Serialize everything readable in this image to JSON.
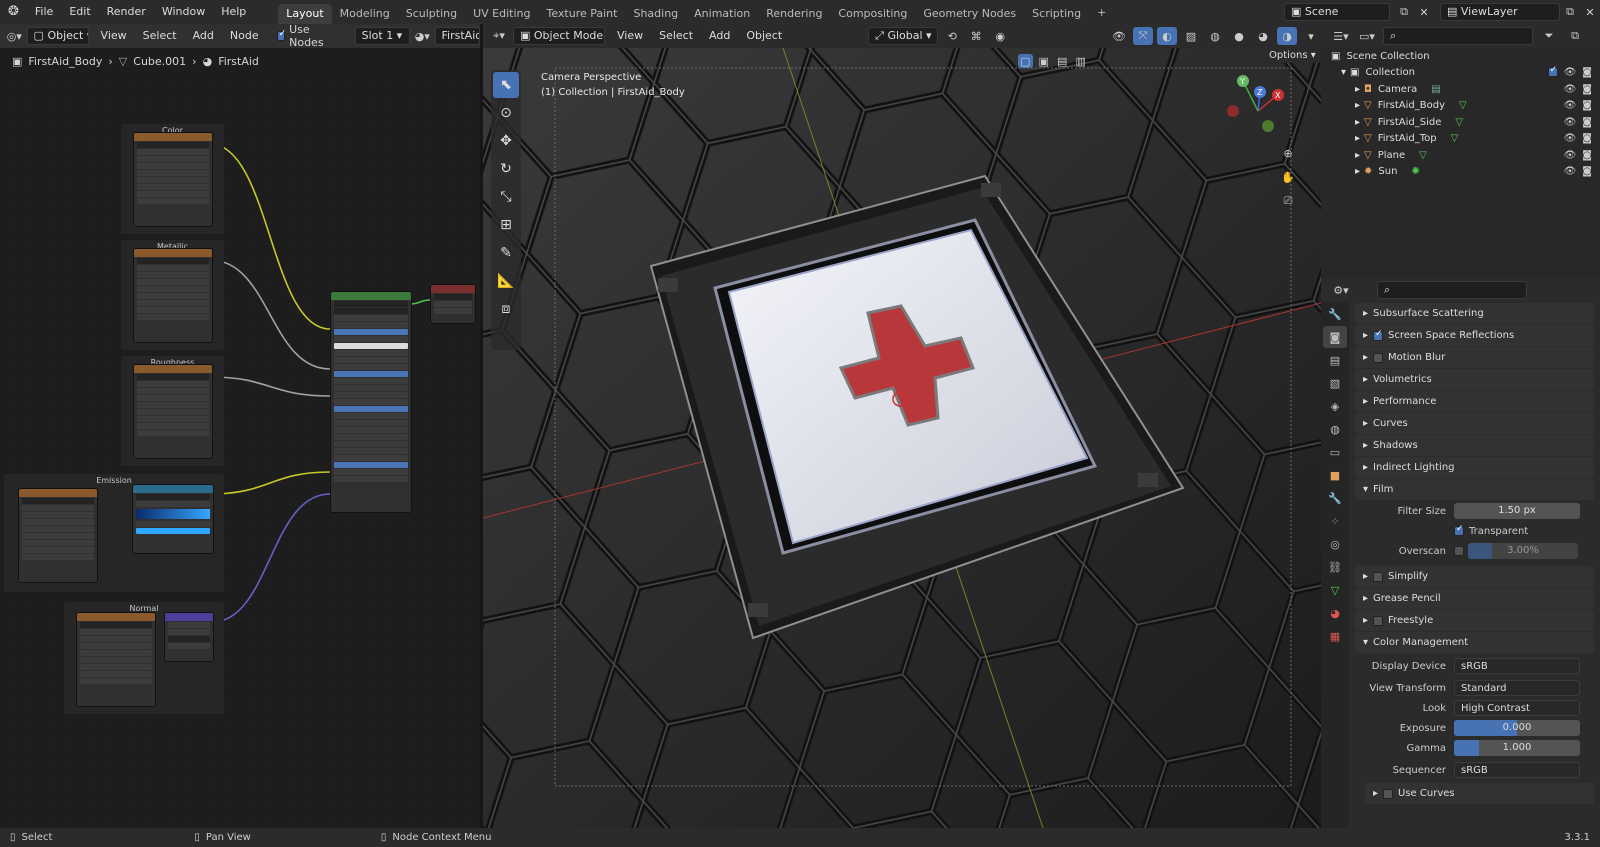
{
  "topbar": {
    "menus": [
      "File",
      "Edit",
      "Render",
      "Window",
      "Help"
    ],
    "workspaces": [
      "Layout",
      "Modeling",
      "Sculpting",
      "UV Editing",
      "Texture Paint",
      "Shading",
      "Animation",
      "Rendering",
      "Compositing",
      "Geometry Nodes",
      "Scripting"
    ],
    "active_workspace": "Layout",
    "add_tab": "+",
    "scene_name": "Scene",
    "view_layer": "ViewLayer"
  },
  "node_editor": {
    "type_label": "Object",
    "menus": [
      "View",
      "Select",
      "Add",
      "Node"
    ],
    "use_nodes_label": "Use Nodes",
    "slot": "Slot 1",
    "material": "FirstAid",
    "breadcrumb": [
      "FirstAid_Body",
      "Cube.001",
      "FirstAid"
    ],
    "frames": {
      "color": "Color",
      "metallic": "Metallic",
      "roughness": "Roughness",
      "emission": "Emission",
      "normal": "Normal"
    }
  },
  "viewport": {
    "mode": "Object Mode",
    "menus": [
      "View",
      "Select",
      "Add",
      "Object"
    ],
    "transform_orientation": "Global",
    "options_label": "Options",
    "overlay_title": "Camera Perspective",
    "overlay_sub": "(1) Collection | FirstAid_Body",
    "gizmo": {
      "x": "X",
      "y": "Y",
      "z": "Z"
    }
  },
  "outliner": {
    "root": "Scene Collection",
    "collection": "Collection",
    "items": [
      "Camera",
      "FirstAid_Body",
      "FirstAid_Side",
      "FirstAid_Top",
      "Plane",
      "Sun"
    ]
  },
  "properties": {
    "sections_top": [
      {
        "label": "Subsurface Scattering",
        "checkbox": null
      },
      {
        "label": "Screen Space Reflections",
        "checkbox": true
      },
      {
        "label": "Motion Blur",
        "checkbox": false
      },
      {
        "label": "Volumetrics",
        "checkbox": null
      },
      {
        "label": "Performance",
        "checkbox": null
      },
      {
        "label": "Curves",
        "checkbox": null
      },
      {
        "label": "Shadows",
        "checkbox": null
      },
      {
        "label": "Indirect Lighting",
        "checkbox": null
      }
    ],
    "film": {
      "title": "Film",
      "filter_size_label": "Filter Size",
      "filter_size": "1.50 px",
      "transparent_label": "Transparent",
      "transparent": true,
      "overscan_label": "Overscan",
      "overscan": "3.00%"
    },
    "sections_mid": [
      {
        "label": "Simplify",
        "checkbox": false
      },
      {
        "label": "Grease Pencil",
        "checkbox": null
      },
      {
        "label": "Freestyle",
        "checkbox": false
      }
    ],
    "color_management": {
      "title": "Color Management",
      "display_device_label": "Display Device",
      "display_device": "sRGB",
      "view_transform_label": "View Transform",
      "view_transform": "Standard",
      "look_label": "Look",
      "look": "High Contrast",
      "exposure_label": "Exposure",
      "exposure": "0.000",
      "gamma_label": "Gamma",
      "gamma": "1.000",
      "sequencer_label": "Sequencer",
      "sequencer": "sRGB",
      "use_curves_label": "Use Curves"
    }
  },
  "statusbar": {
    "select": "Select",
    "pan": "Pan View",
    "context": "Node Context Menu",
    "version": "3.3.1"
  },
  "colors": {
    "accent": "#4772b3",
    "cross_red": "#c0393c",
    "wire_yellow": "#c7c729",
    "wire_grey": "#a1a1a1",
    "wire_purple": "#6363c7"
  }
}
